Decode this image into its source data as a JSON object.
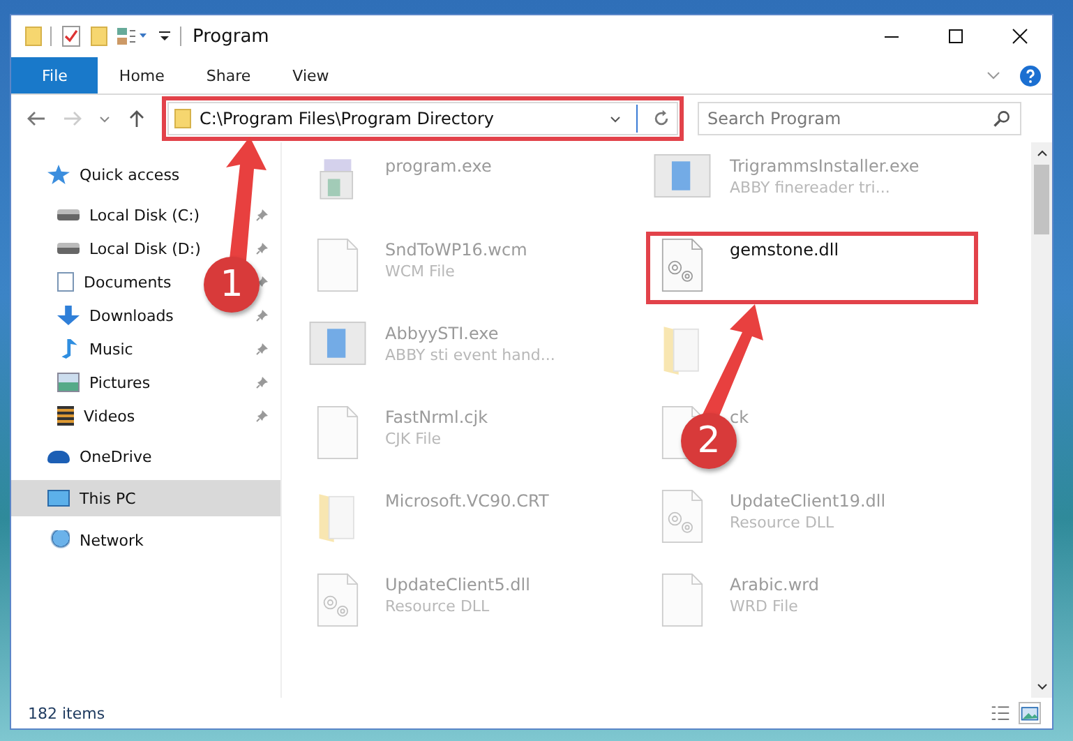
{
  "window": {
    "title": "Program"
  },
  "ribbon_tabs": [
    {
      "label": "File",
      "selected": true
    },
    {
      "label": "Home",
      "selected": false
    },
    {
      "label": "Share",
      "selected": false
    },
    {
      "label": "View",
      "selected": false
    }
  ],
  "address": {
    "path": "C:\\Program Files\\Program Directory",
    "highlighted": true
  },
  "search": {
    "placeholder": "Search Program"
  },
  "sidebar": {
    "items": [
      {
        "label": "Quick access",
        "kind": "star",
        "selected": false,
        "children": [
          {
            "label": "Local Disk (C:)",
            "kind": "disk",
            "pinned": true,
            "selected": false
          },
          {
            "label": "Local Disk (D:)",
            "kind": "disk",
            "pinned": true,
            "selected": false
          },
          {
            "label": "Documents",
            "kind": "doc",
            "pinned": true,
            "selected": false
          },
          {
            "label": "Downloads",
            "kind": "download",
            "pinned": true,
            "selected": false
          },
          {
            "label": "Music",
            "kind": "music",
            "pinned": true,
            "selected": false
          },
          {
            "label": "Pictures",
            "kind": "picture",
            "pinned": true,
            "selected": false
          },
          {
            "label": "Videos",
            "kind": "video",
            "pinned": true,
            "selected": false
          }
        ]
      },
      {
        "label": "OneDrive",
        "kind": "cloud",
        "selected": false
      },
      {
        "label": "This PC",
        "kind": "pc",
        "selected": true
      },
      {
        "label": "Network",
        "kind": "network",
        "selected": false
      }
    ]
  },
  "files": [
    {
      "name": "program.exe",
      "kind": "setup",
      "highlighted": false
    },
    {
      "name": "TrigrammsInstaller.exe",
      "type": "ABBY finereader tri...",
      "kind": "app",
      "highlighted": false
    },
    {
      "name": "SndToWP16.wcm",
      "type": "WCM File",
      "kind": "doc",
      "highlighted": false
    },
    {
      "name": "gemstone.dll",
      "kind": "dll",
      "highlighted": true
    },
    {
      "name": "AbbyySTI.exe",
      "type": "ABBY sti event hand...",
      "kind": "app",
      "highlighted": false
    },
    {
      "kind": "folder",
      "highlighted": false
    },
    {
      "name": "FastNrml.cjk",
      "type": "CJK File",
      "kind": "doc",
      "highlighted": false
    },
    {
      "name": "ck",
      "kind": "doc",
      "highlighted": false
    },
    {
      "name": "Microsoft.VC90.CRT",
      "kind": "folder",
      "highlighted": false
    },
    {
      "name": "UpdateClient19.dll",
      "type": "Resource DLL",
      "kind": "dll",
      "highlighted": false
    },
    {
      "name": "UpdateClient5.dll",
      "type": "Resource DLL",
      "kind": "dll",
      "highlighted": false
    },
    {
      "name": "Arabic.wrd",
      "type": "WRD File",
      "kind": "doc",
      "highlighted": false
    }
  ],
  "status_bar": {
    "count": "182 items"
  },
  "annotations": [
    {
      "label": "1"
    },
    {
      "label": "2"
    }
  ]
}
